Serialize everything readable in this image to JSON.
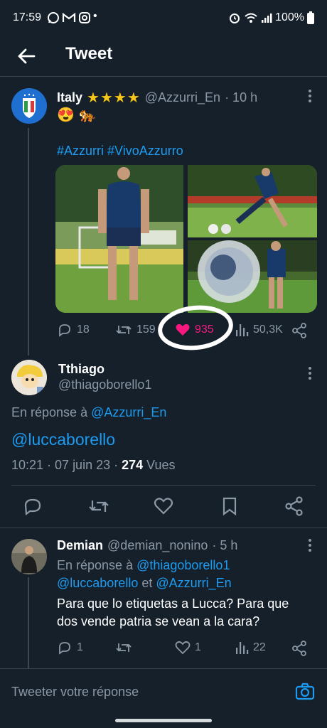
{
  "status_bar": {
    "time": "17:59",
    "dot": "•",
    "battery": "100%"
  },
  "header": {
    "title": "Tweet"
  },
  "main_tweet": {
    "name": "Italy",
    "stars": "★★★★",
    "handle": "@Azzurri_En",
    "time": "· 10 h",
    "emojis": "😍 🐅",
    "hashtags": "#Azzurri #VivoAzzurro",
    "stats": {
      "replies": "18",
      "retweets": "159",
      "likes": "935",
      "views": "50,3K"
    }
  },
  "focus_tweet": {
    "name": "Tthiago",
    "handle": "@thiagoborello1",
    "reply_prefix": "En réponse à",
    "reply_to": "@Azzurri_En",
    "text": "@luccaborello",
    "time_date": "10:21 · 07 juin 23 · ",
    "views_count": "274",
    "views_label": " Vues"
  },
  "reply_tweet": {
    "name": "Demian",
    "handle": "@demian_nonino",
    "time": "· 5 h",
    "reply_prefix": "En réponse à",
    "reply_to_1": "@thiagoborello1",
    "reply_to_2": "@luccaborello",
    "reply_and": " et ",
    "reply_to_3": "@Azzurri_En",
    "text": "Para que lo etiquetas a Lucca? Para que dos vende patria se vean a la cara?",
    "stats": {
      "replies": "1",
      "likes": "1",
      "views": "22"
    }
  },
  "composer": {
    "placeholder": "Tweeter votre réponse"
  },
  "colors": {
    "background": "#15202b",
    "accent": "#1d9bf0",
    "like_pink": "#f91880",
    "muted": "#8b98a5"
  }
}
